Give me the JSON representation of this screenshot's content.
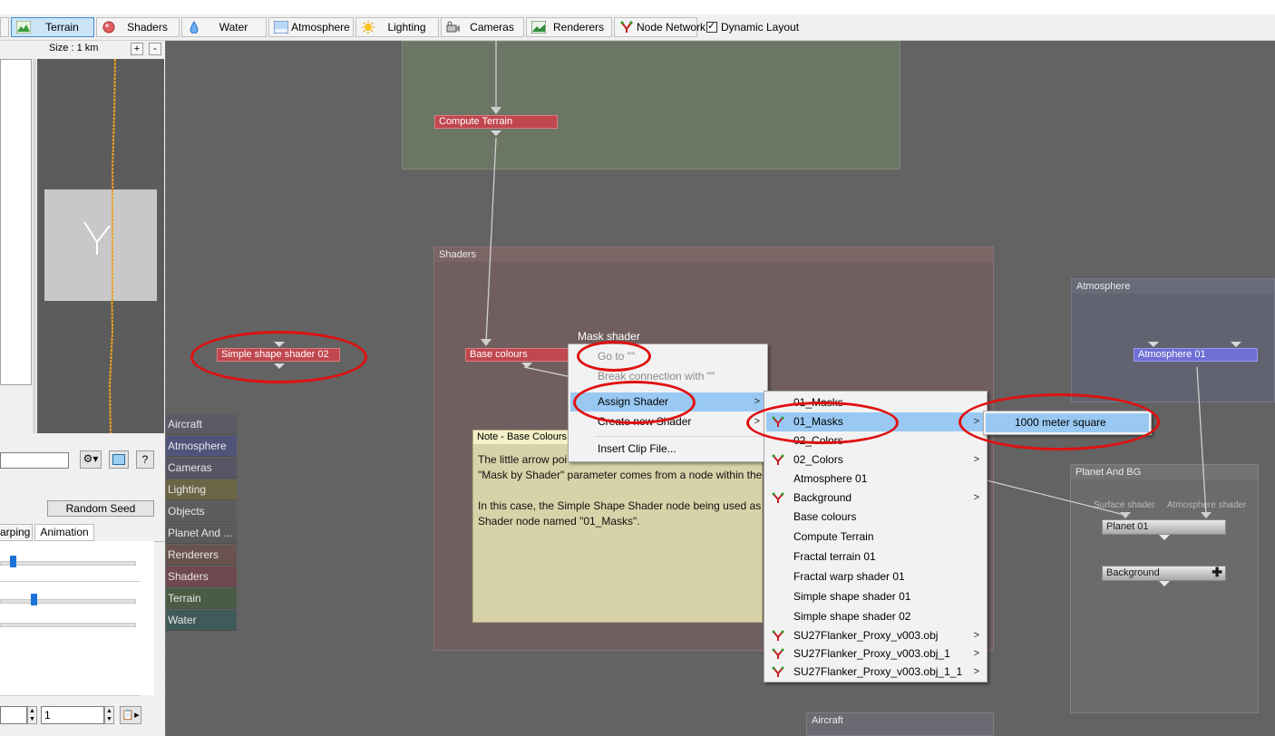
{
  "toolbar": {
    "tabs": [
      {
        "label": "Terrain",
        "icon": "terrain-icon"
      },
      {
        "label": "Shaders",
        "icon": "shaders-icon"
      },
      {
        "label": "Water",
        "icon": "water-icon"
      },
      {
        "label": "Atmosphere",
        "icon": "atmosphere-icon"
      },
      {
        "label": "Lighting",
        "icon": "lighting-icon"
      },
      {
        "label": "Cameras",
        "icon": "cameras-icon"
      },
      {
        "label": "Renderers",
        "icon": "renderers-icon"
      },
      {
        "label": "Node Network",
        "icon": "node-network-icon"
      }
    ],
    "active_tab": "Terrain",
    "dynamic_layout_label": "Dynamic Layout",
    "dynamic_layout_checked": true
  },
  "minimap": {
    "size_label": "Size : 1 km",
    "zoom_in": "+",
    "zoom_out": "-"
  },
  "left_panel": {
    "random_seed_label": "Random Seed",
    "tabs": [
      "arping",
      "Animation"
    ],
    "spin_value": "1",
    "help": "?"
  },
  "categories": [
    "Aircraft",
    "Atmosphere",
    "Cameras",
    "Lighting",
    "Objects",
    "Planet And ...",
    "Renderers",
    "Shaders",
    "Terrain",
    "Water"
  ],
  "canvas": {
    "compute_terrain": "Compute Terrain",
    "shaders_group": "Shaders",
    "base_colours": "Base colours",
    "mask_shader_label": "Mask shader",
    "simple_shape_shader_02": "Simple shape shader 02",
    "atmosphere_group": "Atmosphere",
    "atmosphere_01": "Atmosphere 01",
    "planet_group": "Planet And BG",
    "surface_shader": "Surface shader",
    "atmosphere_shader": "Atmosphere shader",
    "planet_01": "Planet 01",
    "background": "Background",
    "aircraft_group": "Aircraft"
  },
  "note": {
    "title": "Note - Base Colours",
    "lines": [
      "The little arrow poi",
      "\"Mask by Shader\" parameter comes from a node within the",
      "",
      "In this case, the Simple Shape Shader node being used as",
      "Shader node named \"01_Masks\"."
    ]
  },
  "context_menu": {
    "items": [
      "Go to \"\"",
      "Break connection with \"\"",
      "Assign Shader",
      "Create new Shader",
      "Insert Clip File..."
    ]
  },
  "assign_submenu": {
    "items": [
      "01_Masks",
      "01_Masks",
      "02_Colors",
      "02_Colors",
      "Atmosphere 01",
      "Background",
      "Base colours",
      "Compute Terrain",
      "Fractal terrain 01",
      "Fractal warp shader 01",
      "Simple shape shader 01",
      "Simple shape shader 02",
      "SU27Flanker_Proxy_v003.obj",
      "SU27Flanker_Proxy_v003.obj_1",
      "SU27Flanker_Proxy_v003.obj_1_1"
    ]
  },
  "masks_submenu": {
    "items": [
      "1000 meter square"
    ]
  },
  "colors": {
    "annotation_red": "#e01010",
    "highlight": "#99c9f3",
    "node_red": "#c0474e",
    "node_blue": "#6f6fd6"
  }
}
